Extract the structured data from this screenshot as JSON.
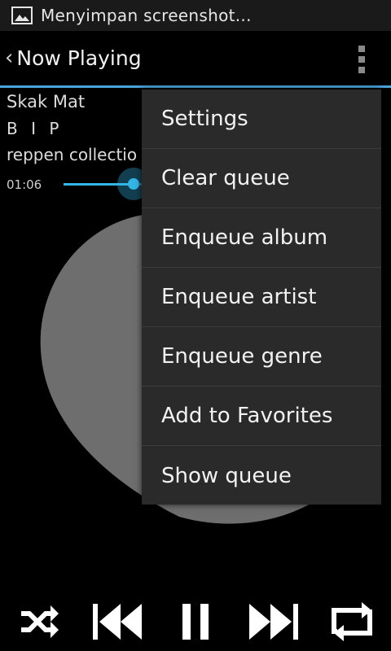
{
  "status_bar": {
    "text": "Menyimpan screenshot...",
    "icon": "image-icon"
  },
  "action_bar": {
    "back_icon": "chevron-left-icon",
    "title": "Now Playing",
    "overflow_icon": "overflow-menu-icon"
  },
  "track": {
    "title": "Skak Mat",
    "artist": "B I P",
    "album": "reppen collectio",
    "elapsed": "01:06",
    "progress": 0.22
  },
  "menu": {
    "items": [
      {
        "label": "Settings"
      },
      {
        "label": "Clear queue"
      },
      {
        "label": "Enqueue album"
      },
      {
        "label": "Enqueue artist"
      },
      {
        "label": "Enqueue genre"
      },
      {
        "label": "Add to Favorites"
      },
      {
        "label": "Show queue"
      }
    ]
  },
  "controls": {
    "shuffle_icon": "shuffle-icon",
    "previous_icon": "skip-previous-icon",
    "pause_icon": "pause-icon",
    "next_icon": "skip-next-icon",
    "repeat_icon": "repeat-icon"
  },
  "colors": {
    "accent": "#33b5e5",
    "menu_bg": "#2a2a2a",
    "art_fill": "#6e6e6e"
  }
}
